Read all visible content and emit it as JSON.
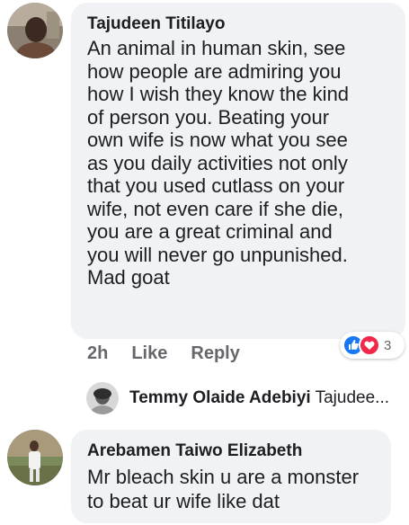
{
  "comments": [
    {
      "author": "Tajudeen Titilayo",
      "text": "An animal in human skin, see\nhow people are admiring you\nhow I wish they know the kind\nof person you. Beating your\nown wife is now what you see\nas you daily activities not only\nthat you used cutlass on your\nwife, not even care if she die,\nyou are a great criminal and\nyou will never go unpunished.\nMad goat",
      "time": "2h",
      "like_label": "Like",
      "reply_label": "Reply",
      "reaction_count": "3",
      "reactions": [
        "like-icon",
        "love-icon"
      ],
      "reply_preview": {
        "author": "Temmy Olaide Adebiyi",
        "text": "Tajudee..."
      }
    },
    {
      "author": "Arebamen Taiwo Elizabeth",
      "text": "Mr bleach skin u are a monster\nto beat ur wife like dat"
    }
  ],
  "colors": {
    "bubble": "#f0f2f5",
    "meta": "#65676b",
    "like_reaction": "#1877f2",
    "love_reaction": "#f0284a"
  }
}
